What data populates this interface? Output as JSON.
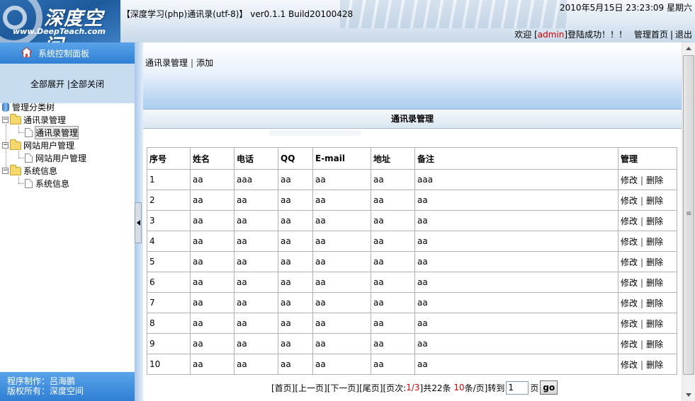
{
  "header": {
    "logo_text": "深度空间",
    "logo_site": "www.DeepTeach.com",
    "app_title": "【深度学习(php)通讯录(utf-8)】 ver0.1.1 Build20100428",
    "datetime": "2010年5月15日  23:23:09 星期六",
    "welcome_prefix": "欢迎 [",
    "username": "admin",
    "welcome_suffix": "]登陆成功！！！",
    "admin_home": "管理首页",
    "logout": "退出"
  },
  "sidebar": {
    "title": "系统控制面板",
    "expand_all": "全部展开",
    "collapse_all": "全部关闭",
    "tree_root": "管理分类树",
    "groups": [
      {
        "label": "通讯录管理",
        "child": "通讯录管理"
      },
      {
        "label": "网站用户管理",
        "child": "网站用户管理"
      },
      {
        "label": "系统信息",
        "child": "系统信息"
      }
    ],
    "credit_line1": "程序制作：吕海鹏",
    "credit_line2": "版权所有：深度空间"
  },
  "main": {
    "nav_manage": "通讯录管理",
    "nav_add": "添加",
    "table_title": "通讯录管理",
    "columns": [
      "序号",
      "姓名",
      "电话",
      "QQ",
      "E-mail",
      "地址",
      "备注",
      "管理"
    ],
    "rows": [
      {
        "id": "1",
        "name": "aa",
        "phone": "aaa",
        "qq": "aa",
        "email": "aa",
        "address": "aa",
        "note": "aaa"
      },
      {
        "id": "2",
        "name": "aa",
        "phone": "aa",
        "qq": "aa",
        "email": "aa",
        "address": "aa",
        "note": "aa"
      },
      {
        "id": "3",
        "name": "aa",
        "phone": "aa",
        "qq": "aa",
        "email": "aa",
        "address": "aa",
        "note": "aa"
      },
      {
        "id": "4",
        "name": "aa",
        "phone": "aa",
        "qq": "aa",
        "email": "aa",
        "address": "aa",
        "note": "aa"
      },
      {
        "id": "5",
        "name": "aa",
        "phone": "aa",
        "qq": "aa",
        "email": "aa",
        "address": "aa",
        "note": "aa"
      },
      {
        "id": "6",
        "name": "aa",
        "phone": "aa",
        "qq": "aa",
        "email": "aa",
        "address": "aa",
        "note": "aa"
      },
      {
        "id": "7",
        "name": "aa",
        "phone": "aa",
        "qq": "aa",
        "email": "aa",
        "address": "aa",
        "note": "aa"
      },
      {
        "id": "8",
        "name": "aa",
        "phone": "aa",
        "qq": "aa",
        "email": "aa",
        "address": "aa",
        "note": "aa"
      },
      {
        "id": "9",
        "name": "aa",
        "phone": "aa",
        "qq": "aa",
        "email": "aa",
        "address": "aa",
        "note": "aa"
      },
      {
        "id": "10",
        "name": "aa",
        "phone": "aa",
        "qq": "aa",
        "email": "aa",
        "address": "aa",
        "note": "aa"
      }
    ],
    "edit_label": "修改",
    "delete_label": "删除"
  },
  "pager": {
    "first": "[首页]",
    "prev": "[上一页]",
    "next": "[下一页]",
    "last": "[尾页]",
    "page_label": "[页次:",
    "page_current": "1/3",
    "total_label": "]共22条",
    "per_page_num": "10",
    "per_page_suffix": "条/页]",
    "goto_label": "转到",
    "page_value": "1",
    "page_unit": "页",
    "go": "go"
  },
  "colors": {
    "accent_blue": "#2f7fd3",
    "highlight_red": "#d40000"
  }
}
